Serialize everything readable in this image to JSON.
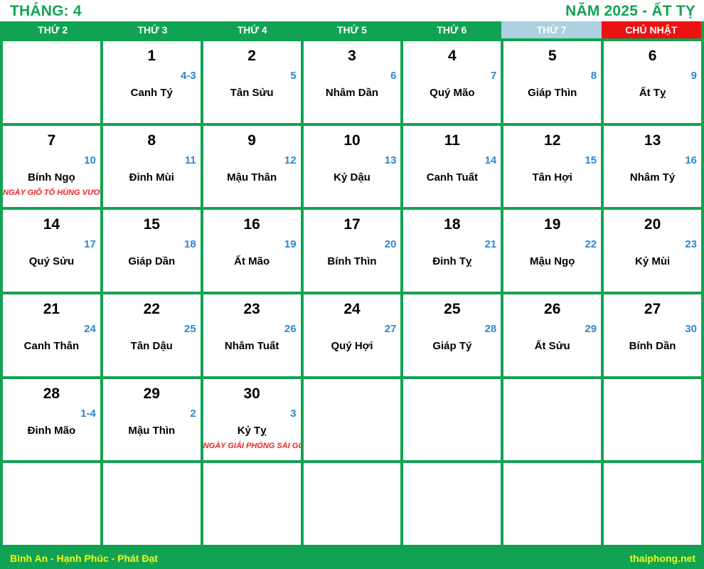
{
  "header": {
    "month_label": "THÁNG: 4",
    "year_label": "NĂM 2025 - ẤT TỴ",
    "title_color": "#11a353"
  },
  "theme": {
    "green": "#11a353",
    "saturday_bg": "#aed0e0",
    "sunday_bg": "#ee1111",
    "lunar_blue": "#2e86d0",
    "holiday_red": "#ee2222",
    "footer_text": "#f7f70e"
  },
  "weekdays": [
    {
      "label": "THỨ 2",
      "variant": "weekday"
    },
    {
      "label": "THỨ 3",
      "variant": "weekday"
    },
    {
      "label": "THỨ 4",
      "variant": "weekday"
    },
    {
      "label": "THỨ 5",
      "variant": "weekday"
    },
    {
      "label": "THỨ 6",
      "variant": "weekday"
    },
    {
      "label": "THỨ 7",
      "variant": "saturday"
    },
    {
      "label": "CHỦ NHẬT",
      "variant": "sunday"
    }
  ],
  "weeks": [
    [
      {
        "empty": true
      },
      {
        "solar": "1",
        "lunar": "4-3",
        "canchi": "Canh Tý"
      },
      {
        "solar": "2",
        "lunar": "5",
        "canchi": "Tân Sửu"
      },
      {
        "solar": "3",
        "lunar": "6",
        "canchi": "Nhâm Dần"
      },
      {
        "solar": "4",
        "lunar": "7",
        "canchi": "Quý Mão"
      },
      {
        "solar": "5",
        "lunar": "8",
        "canchi": "Giáp Thìn"
      },
      {
        "solar": "6",
        "lunar": "9",
        "canchi": "Ất Tỵ"
      }
    ],
    [
      {
        "solar": "7",
        "lunar": "10",
        "canchi": "Bính Ngọ",
        "holiday": "NGÀY GIỖ TỔ HÙNG VƯƠNG"
      },
      {
        "solar": "8",
        "lunar": "11",
        "canchi": "Đinh Mùi"
      },
      {
        "solar": "9",
        "lunar": "12",
        "canchi": "Mậu Thân"
      },
      {
        "solar": "10",
        "lunar": "13",
        "canchi": "Kỷ Dậu"
      },
      {
        "solar": "11",
        "lunar": "14",
        "canchi": "Canh Tuất"
      },
      {
        "solar": "12",
        "lunar": "15",
        "canchi": "Tân Hợi"
      },
      {
        "solar": "13",
        "lunar": "16",
        "canchi": "Nhâm Tý"
      }
    ],
    [
      {
        "solar": "14",
        "lunar": "17",
        "canchi": "Quý Sửu"
      },
      {
        "solar": "15",
        "lunar": "18",
        "canchi": "Giáp Dần"
      },
      {
        "solar": "16",
        "lunar": "19",
        "canchi": "Ất Mão"
      },
      {
        "solar": "17",
        "lunar": "20",
        "canchi": "Bính Thìn"
      },
      {
        "solar": "18",
        "lunar": "21",
        "canchi": "Đinh Tỵ"
      },
      {
        "solar": "19",
        "lunar": "22",
        "canchi": "Mậu Ngọ"
      },
      {
        "solar": "20",
        "lunar": "23",
        "canchi": "Kỷ Mùi"
      }
    ],
    [
      {
        "solar": "21",
        "lunar": "24",
        "canchi": "Canh Thân"
      },
      {
        "solar": "22",
        "lunar": "25",
        "canchi": "Tân Dậu"
      },
      {
        "solar": "23",
        "lunar": "26",
        "canchi": "Nhâm Tuất"
      },
      {
        "solar": "24",
        "lunar": "27",
        "canchi": "Quý Hợi"
      },
      {
        "solar": "25",
        "lunar": "28",
        "canchi": "Giáp Tý"
      },
      {
        "solar": "26",
        "lunar": "29",
        "canchi": "Ất Sửu"
      },
      {
        "solar": "27",
        "lunar": "30",
        "canchi": "Bính Dần"
      }
    ],
    [
      {
        "solar": "28",
        "lunar": "1-4",
        "canchi": "Đinh Mão"
      },
      {
        "solar": "29",
        "lunar": "2",
        "canchi": "Mậu Thìn"
      },
      {
        "solar": "30",
        "lunar": "3",
        "canchi": "Kỷ Tỵ",
        "holiday": "NGÀY GIẢI PHÓNG SÀI GÒN"
      },
      {
        "empty": true
      },
      {
        "empty": true
      },
      {
        "empty": true
      },
      {
        "empty": true
      }
    ],
    [
      {
        "empty": true
      },
      {
        "empty": true
      },
      {
        "empty": true
      },
      {
        "empty": true
      },
      {
        "empty": true
      },
      {
        "empty": true
      },
      {
        "empty": true
      }
    ]
  ],
  "footer": {
    "slogan": "Bình An - Hạnh Phúc - Phát Đạt",
    "site": "thaiphong.net"
  }
}
